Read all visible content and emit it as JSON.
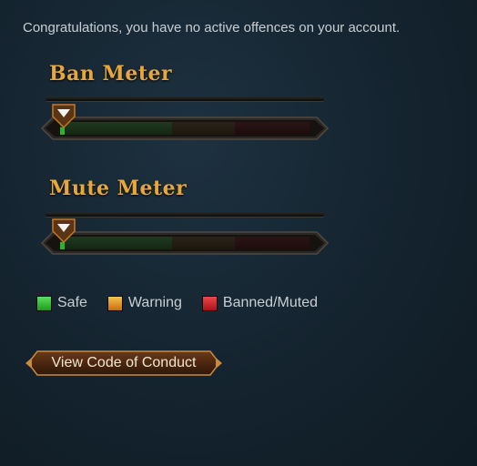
{
  "intro_text": "Congratulations, you have no active offences on your account.",
  "meters": {
    "ban": {
      "title": "Ban Meter",
      "level": 0.02
    },
    "mute": {
      "title": "Mute Meter",
      "level": 0.02
    }
  },
  "legend": [
    {
      "label": "Safe",
      "color": "#2fc22f"
    },
    {
      "label": "Warning",
      "color": "#e8a126"
    },
    {
      "label": "Banned/Muted",
      "color": "#d8262b"
    }
  ],
  "cta": {
    "label": "View Code of Conduct"
  }
}
